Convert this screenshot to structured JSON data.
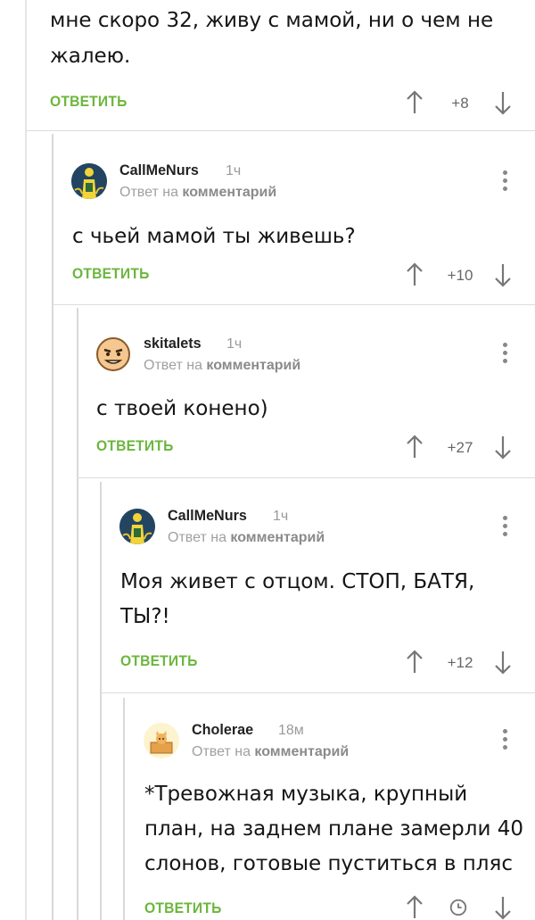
{
  "top_comment": {
    "text_line1": "мне скоро 32, живу с мамой, ни о чем не",
    "text_line2": "жалею.",
    "reply_label": "ОТВЕТИТЬ",
    "score": "+8"
  },
  "comments": [
    {
      "username": "CallMeNurs",
      "time": "1ч",
      "reply_prefix": "Ответ на",
      "reply_target": "комментарий",
      "text": [
        "с чьей мамой ты живешь?"
      ],
      "reply_label": "ОТВЕТИТЬ",
      "score": "+10",
      "avatar": "yellow-figure-avatar"
    },
    {
      "username": "skitalets",
      "time": "1ч",
      "reply_prefix": "Ответ на",
      "reply_target": "комментарий",
      "text": [
        "с твоей конено)"
      ],
      "reply_label": "ОТВЕТИТЬ",
      "score": "+27",
      "avatar": "cartoon-face-avatar"
    },
    {
      "username": "CallMeNurs",
      "time": "1ч",
      "reply_prefix": "Ответ на",
      "reply_target": "комментарий",
      "text": [
        "Моя живет с отцом. СТОП, БАТЯ,",
        "ТЫ?!"
      ],
      "reply_label": "ОТВЕТИТЬ",
      "score": "+12",
      "avatar": "yellow-figure-avatar"
    },
    {
      "username": "Cholerae",
      "time": "18м",
      "reply_prefix": "Ответ на",
      "reply_target": "комментарий",
      "text": [
        "*Тревожная музыка, крупный",
        "план, на заднем плане замерли 40",
        "слонов, готовые пуститься в пляс"
      ],
      "reply_label": "ОТВЕТИТЬ",
      "score": "",
      "avatar": "cat-in-box-avatar"
    }
  ],
  "colors": {
    "accent_green": "#6cb63d",
    "thread_line": "#d9d9d9",
    "meta_gray": "#9a9a9a"
  },
  "icons": {
    "upvote": "arrow-up-icon",
    "downvote": "arrow-down-icon",
    "menu": "kebab-menu-icon",
    "pending": "clock-icon"
  }
}
